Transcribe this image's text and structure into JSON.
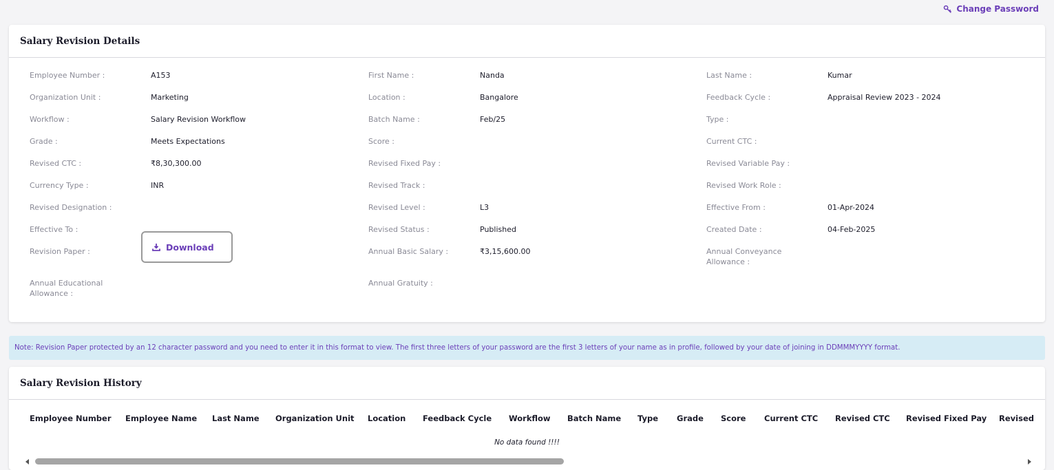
{
  "topbar": {
    "change_password": "Change Password"
  },
  "details": {
    "title": "Salary Revision Details",
    "fields": [
      {
        "label": "Employee Number :",
        "value": "A153"
      },
      {
        "label": "First Name :",
        "value": "Nanda"
      },
      {
        "label": "Last Name :",
        "value": "Kumar"
      },
      {
        "label": "Organization Unit :",
        "value": "Marketing"
      },
      {
        "label": "Location :",
        "value": "Bangalore"
      },
      {
        "label": "Feedback Cycle :",
        "value": "Appraisal Review 2023 - 2024"
      },
      {
        "label": "Workflow :",
        "value": "Salary Revision Workflow"
      },
      {
        "label": "Batch Name :",
        "value": "Feb/25"
      },
      {
        "label": "Type :",
        "value": ""
      },
      {
        "label": "Grade :",
        "value": "Meets Expectations"
      },
      {
        "label": "Score :",
        "value": ""
      },
      {
        "label": "Current CTC :",
        "value": ""
      },
      {
        "label": "Revised CTC :",
        "value": "₹8,30,300.00"
      },
      {
        "label": "Revised Fixed Pay :",
        "value": ""
      },
      {
        "label": "Revised Variable Pay :",
        "value": ""
      },
      {
        "label": "Currency Type :",
        "value": "INR"
      },
      {
        "label": "Revised Track :",
        "value": ""
      },
      {
        "label": "Revised Work Role :",
        "value": ""
      },
      {
        "label": "Revised Designation :",
        "value": ""
      },
      {
        "label": "Revised Level :",
        "value": "L3"
      },
      {
        "label": "Effective From :",
        "value": "01-Apr-2024"
      },
      {
        "label": "Effective To :",
        "value": ""
      },
      {
        "label": "Revised Status :",
        "value": "Published"
      },
      {
        "label": "Created Date :",
        "value": "04-Feb-2025"
      },
      {
        "label": "Revision Paper :",
        "value": ""
      },
      {
        "label": "Annual Basic Salary :",
        "value": "₹3,15,600.00"
      },
      {
        "label": "Annual Conveyance Allowance :",
        "value": ""
      },
      {
        "label": "Annual Educational Allowance :",
        "value": ""
      },
      {
        "label": "Annual Gratuity :",
        "value": ""
      }
    ],
    "download_label": "Download"
  },
  "note": "Note: Revision Paper protected by an 12 character password and you need to enter it in this format to view. The first three letters of your password are the first 3 letters of your name as in profile, followed by your date of joining in DDMMMYYYY format.",
  "history": {
    "title": "Salary Revision History",
    "columns": [
      "Employee Number",
      "Employee Name",
      "Last Name",
      "Organization Unit",
      "Location",
      "Feedback Cycle",
      "Workflow",
      "Batch Name",
      "Type",
      "Grade",
      "Score",
      "Current CTC",
      "Revised CTC",
      "Revised Fixed Pay",
      "Revised"
    ],
    "empty_message": "No data found !!!!"
  },
  "colors": {
    "accent": "#6b3fb8",
    "note_bg": "#d6ecf5"
  },
  "icons": {
    "change_password": "key-icon",
    "download": "download-icon"
  }
}
